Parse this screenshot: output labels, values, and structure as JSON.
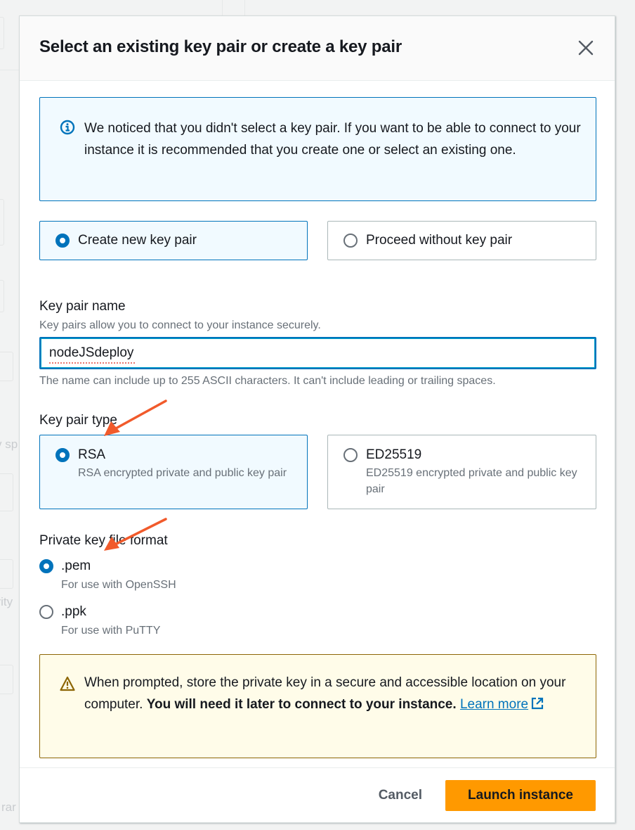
{
  "background": {
    "fragments": [
      "v sp",
      "urity",
      "rar"
    ]
  },
  "modal": {
    "title": "Select an existing key pair or create a key pair",
    "close_icon": "close-icon"
  },
  "info_alert": {
    "icon": "info-icon",
    "text": "We noticed that you didn't select a key pair. If you want to be able to connect to your instance it is recommended that you create one or select an existing one."
  },
  "key_pair_choice": {
    "options": [
      {
        "label": "Create new key pair",
        "selected": true
      },
      {
        "label": "Proceed without key pair",
        "selected": false
      }
    ]
  },
  "key_pair_name": {
    "label": "Key pair name",
    "description": "Key pairs allow you to connect to your instance securely.",
    "value": "nodeJSdeploy",
    "constraint": "The name can include up to 255 ASCII characters. It can't include leading or trailing spaces."
  },
  "key_pair_type": {
    "label": "Key pair type",
    "options": [
      {
        "label": "RSA",
        "description": "RSA encrypted private and public key pair",
        "selected": true
      },
      {
        "label": "ED25519",
        "description": "ED25519 encrypted private and public key pair",
        "selected": false
      }
    ]
  },
  "private_key_format": {
    "label": "Private key file format",
    "options": [
      {
        "label": ".pem",
        "description": "For use with OpenSSH",
        "selected": true
      },
      {
        "label": ".ppk",
        "description": "For use with PuTTY",
        "selected": false
      }
    ]
  },
  "warning_alert": {
    "icon": "warning-icon",
    "text_normal": "When prompted, store the private key in a secure and accessible location on your computer. ",
    "text_bold": "You will need it later to connect to your instance.",
    "link_label": "Learn more",
    "link_icon": "external-link-icon"
  },
  "footer": {
    "cancel_label": "Cancel",
    "primary_label": "Launch instance"
  },
  "colors": {
    "accent": "#0073bb",
    "primary_button": "#ff9900",
    "info_bg": "#f1faff",
    "warning_bg": "#fffce9",
    "warning_border": "#8d6605",
    "annotation_arrow": "#f15a2b"
  }
}
